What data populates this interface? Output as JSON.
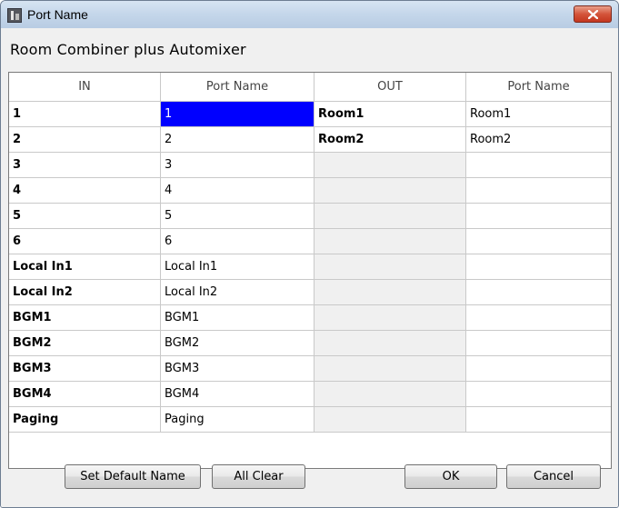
{
  "window": {
    "title": "Port Name",
    "icon": "app-icon",
    "close_icon": "close-icon"
  },
  "heading": "Room Combiner plus Automixer",
  "table": {
    "headers": [
      "IN",
      "Port Name",
      "OUT",
      "Port Name"
    ],
    "rows": [
      {
        "in": "1",
        "in_port": "1",
        "out": "Room1",
        "out_port": "Room1"
      },
      {
        "in": "2",
        "in_port": "2",
        "out": "Room2",
        "out_port": "Room2"
      },
      {
        "in": "3",
        "in_port": "3",
        "out": "",
        "out_port": ""
      },
      {
        "in": "4",
        "in_port": "4",
        "out": "",
        "out_port": ""
      },
      {
        "in": "5",
        "in_port": "5",
        "out": "",
        "out_port": ""
      },
      {
        "in": "6",
        "in_port": "6",
        "out": "",
        "out_port": ""
      },
      {
        "in": "Local In1",
        "in_port": "Local In1",
        "out": "",
        "out_port": ""
      },
      {
        "in": "Local In2",
        "in_port": "Local In2",
        "out": "",
        "out_port": ""
      },
      {
        "in": "BGM1",
        "in_port": "BGM1",
        "out": "",
        "out_port": ""
      },
      {
        "in": "BGM2",
        "in_port": "BGM2",
        "out": "",
        "out_port": ""
      },
      {
        "in": "BGM3",
        "in_port": "BGM3",
        "out": "",
        "out_port": ""
      },
      {
        "in": "BGM4",
        "in_port": "BGM4",
        "out": "",
        "out_port": ""
      },
      {
        "in": "Paging",
        "in_port": "Paging",
        "out": "",
        "out_port": ""
      }
    ],
    "selected_cell": "row 1, in_port"
  },
  "buttons": {
    "set_default": "Set Default Name",
    "all_clear": "All Clear",
    "ok": "OK",
    "cancel": "Cancel"
  },
  "colors": {
    "selection": "#0000ff",
    "close_button": "#c4371f"
  }
}
